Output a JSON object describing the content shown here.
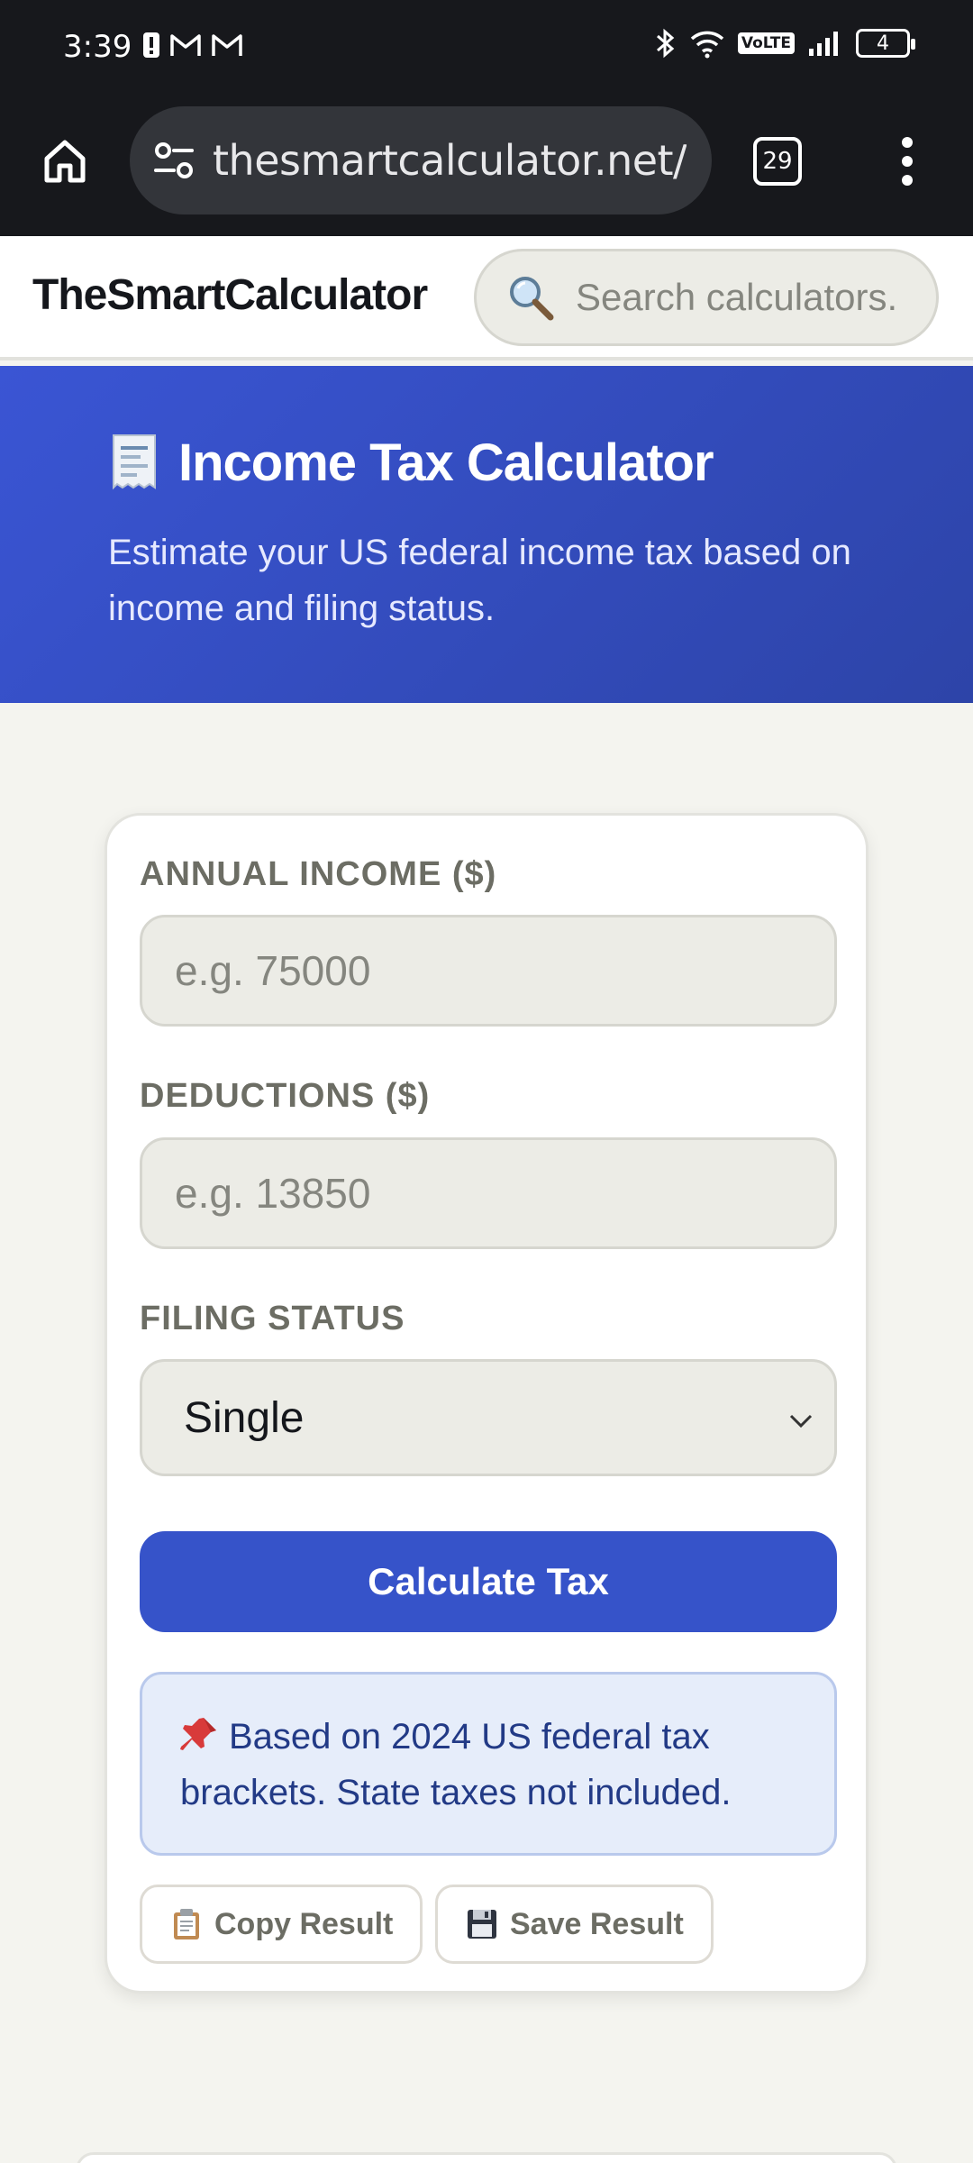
{
  "status_bar": {
    "time": "3:39",
    "volte": "VoLTE",
    "battery": "4"
  },
  "browser": {
    "url": "thesmartcalculator.net/income-tax-calculator",
    "tab_count": "29"
  },
  "site": {
    "brand": "TheSmartCalculator",
    "search_placeholder": "Search calculators..."
  },
  "hero": {
    "title": "Income Tax Calculator",
    "description": "Estimate your US federal income tax based on income and filing status."
  },
  "form": {
    "income_label": "ANNUAL INCOME ($)",
    "income_placeholder": "e.g. 75000",
    "deductions_label": "DEDUCTIONS ($)",
    "deductions_placeholder": "e.g. 13850",
    "filing_label": "FILING STATUS",
    "filing_value": "Single",
    "calculate_label": "Calculate Tax",
    "info_text": "Based on 2024 US federal tax brackets. State taxes not included.",
    "copy_label": "Copy Result",
    "save_label": "Save Result"
  },
  "colors": {
    "hero_bg": "#3a55d4",
    "button_bg": "#3653c9",
    "info_bg": "#e6edfa",
    "info_text": "#223a86"
  }
}
